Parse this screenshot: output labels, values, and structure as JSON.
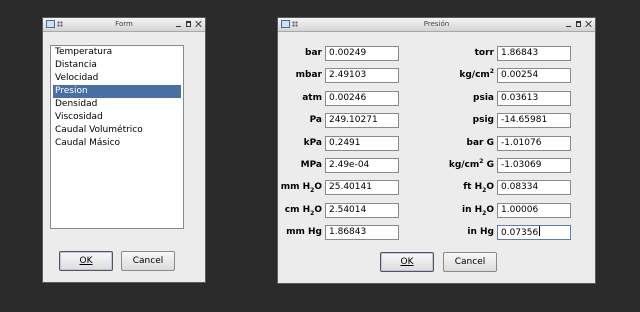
{
  "window1": {
    "title": "Form",
    "items": [
      "Temperatura",
      "Distancia",
      "Velocidad",
      "Presion",
      "Densidad",
      "Viscosidad",
      "Caudal Volumétrico",
      "Caudal Másico"
    ],
    "selected_index": 3,
    "ok_label": "OK",
    "cancel_label": "Cancel"
  },
  "window2": {
    "title": "Presión",
    "left": [
      {
        "unit": "bar",
        "value": "0.00249"
      },
      {
        "unit": "mbar",
        "value": "2.49103"
      },
      {
        "unit": "atm",
        "value": "0.00246"
      },
      {
        "unit": "Pa",
        "value": "249.10271"
      },
      {
        "unit": "kPa",
        "value": "0.2491"
      },
      {
        "unit": "MPa",
        "value": "2.49e-04"
      },
      {
        "unit": "mm H2O",
        "value": "25.40141"
      },
      {
        "unit": "cm H2O",
        "value": "2.54014"
      },
      {
        "unit": "mm Hg",
        "value": "1.86843"
      }
    ],
    "right": [
      {
        "unit": "torr",
        "value": "1.86843"
      },
      {
        "unit": "kg/cm2",
        "value": "0.00254"
      },
      {
        "unit": "psia",
        "value": "0.03613"
      },
      {
        "unit": "psig",
        "value": "-14.65981"
      },
      {
        "unit": "bar G",
        "value": "-1.01076"
      },
      {
        "unit": "kg/cm2 G",
        "value": "-1.03069"
      },
      {
        "unit": "ft H2O",
        "value": "0.08334"
      },
      {
        "unit": "in H2O",
        "value": "1.00006"
      },
      {
        "unit": "in Hg",
        "value": "0.07356"
      }
    ],
    "focused_field": "in Hg",
    "ok_label": "OK",
    "cancel_label": "Cancel"
  }
}
